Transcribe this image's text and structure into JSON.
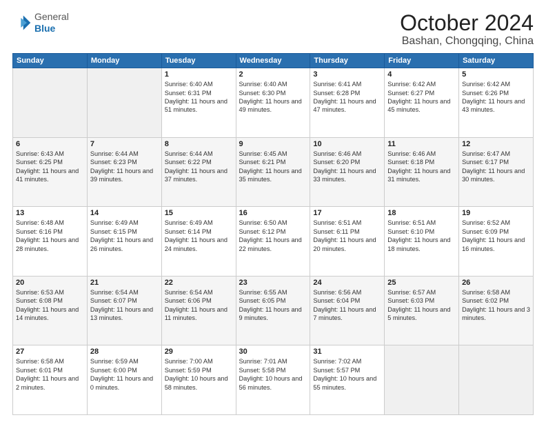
{
  "header": {
    "logo_general": "General",
    "logo_blue": "Blue",
    "title": "October 2024",
    "location": "Bashan, Chongqing, China"
  },
  "days_of_week": [
    "Sunday",
    "Monday",
    "Tuesday",
    "Wednesday",
    "Thursday",
    "Friday",
    "Saturday"
  ],
  "weeks": [
    [
      {
        "num": "",
        "empty": true
      },
      {
        "num": "",
        "empty": true
      },
      {
        "num": "1",
        "sunrise": "Sunrise: 6:40 AM",
        "sunset": "Sunset: 6:31 PM",
        "daylight": "Daylight: 11 hours and 51 minutes."
      },
      {
        "num": "2",
        "sunrise": "Sunrise: 6:40 AM",
        "sunset": "Sunset: 6:30 PM",
        "daylight": "Daylight: 11 hours and 49 minutes."
      },
      {
        "num": "3",
        "sunrise": "Sunrise: 6:41 AM",
        "sunset": "Sunset: 6:28 PM",
        "daylight": "Daylight: 11 hours and 47 minutes."
      },
      {
        "num": "4",
        "sunrise": "Sunrise: 6:42 AM",
        "sunset": "Sunset: 6:27 PM",
        "daylight": "Daylight: 11 hours and 45 minutes."
      },
      {
        "num": "5",
        "sunrise": "Sunrise: 6:42 AM",
        "sunset": "Sunset: 6:26 PM",
        "daylight": "Daylight: 11 hours and 43 minutes."
      }
    ],
    [
      {
        "num": "6",
        "sunrise": "Sunrise: 6:43 AM",
        "sunset": "Sunset: 6:25 PM",
        "daylight": "Daylight: 11 hours and 41 minutes."
      },
      {
        "num": "7",
        "sunrise": "Sunrise: 6:44 AM",
        "sunset": "Sunset: 6:23 PM",
        "daylight": "Daylight: 11 hours and 39 minutes."
      },
      {
        "num": "8",
        "sunrise": "Sunrise: 6:44 AM",
        "sunset": "Sunset: 6:22 PM",
        "daylight": "Daylight: 11 hours and 37 minutes."
      },
      {
        "num": "9",
        "sunrise": "Sunrise: 6:45 AM",
        "sunset": "Sunset: 6:21 PM",
        "daylight": "Daylight: 11 hours and 35 minutes."
      },
      {
        "num": "10",
        "sunrise": "Sunrise: 6:46 AM",
        "sunset": "Sunset: 6:20 PM",
        "daylight": "Daylight: 11 hours and 33 minutes."
      },
      {
        "num": "11",
        "sunrise": "Sunrise: 6:46 AM",
        "sunset": "Sunset: 6:18 PM",
        "daylight": "Daylight: 11 hours and 31 minutes."
      },
      {
        "num": "12",
        "sunrise": "Sunrise: 6:47 AM",
        "sunset": "Sunset: 6:17 PM",
        "daylight": "Daylight: 11 hours and 30 minutes."
      }
    ],
    [
      {
        "num": "13",
        "sunrise": "Sunrise: 6:48 AM",
        "sunset": "Sunset: 6:16 PM",
        "daylight": "Daylight: 11 hours and 28 minutes."
      },
      {
        "num": "14",
        "sunrise": "Sunrise: 6:49 AM",
        "sunset": "Sunset: 6:15 PM",
        "daylight": "Daylight: 11 hours and 26 minutes."
      },
      {
        "num": "15",
        "sunrise": "Sunrise: 6:49 AM",
        "sunset": "Sunset: 6:14 PM",
        "daylight": "Daylight: 11 hours and 24 minutes."
      },
      {
        "num": "16",
        "sunrise": "Sunrise: 6:50 AM",
        "sunset": "Sunset: 6:12 PM",
        "daylight": "Daylight: 11 hours and 22 minutes."
      },
      {
        "num": "17",
        "sunrise": "Sunrise: 6:51 AM",
        "sunset": "Sunset: 6:11 PM",
        "daylight": "Daylight: 11 hours and 20 minutes."
      },
      {
        "num": "18",
        "sunrise": "Sunrise: 6:51 AM",
        "sunset": "Sunset: 6:10 PM",
        "daylight": "Daylight: 11 hours and 18 minutes."
      },
      {
        "num": "19",
        "sunrise": "Sunrise: 6:52 AM",
        "sunset": "Sunset: 6:09 PM",
        "daylight": "Daylight: 11 hours and 16 minutes."
      }
    ],
    [
      {
        "num": "20",
        "sunrise": "Sunrise: 6:53 AM",
        "sunset": "Sunset: 6:08 PM",
        "daylight": "Daylight: 11 hours and 14 minutes."
      },
      {
        "num": "21",
        "sunrise": "Sunrise: 6:54 AM",
        "sunset": "Sunset: 6:07 PM",
        "daylight": "Daylight: 11 hours and 13 minutes."
      },
      {
        "num": "22",
        "sunrise": "Sunrise: 6:54 AM",
        "sunset": "Sunset: 6:06 PM",
        "daylight": "Daylight: 11 hours and 11 minutes."
      },
      {
        "num": "23",
        "sunrise": "Sunrise: 6:55 AM",
        "sunset": "Sunset: 6:05 PM",
        "daylight": "Daylight: 11 hours and 9 minutes."
      },
      {
        "num": "24",
        "sunrise": "Sunrise: 6:56 AM",
        "sunset": "Sunset: 6:04 PM",
        "daylight": "Daylight: 11 hours and 7 minutes."
      },
      {
        "num": "25",
        "sunrise": "Sunrise: 6:57 AM",
        "sunset": "Sunset: 6:03 PM",
        "daylight": "Daylight: 11 hours and 5 minutes."
      },
      {
        "num": "26",
        "sunrise": "Sunrise: 6:58 AM",
        "sunset": "Sunset: 6:02 PM",
        "daylight": "Daylight: 11 hours and 3 minutes."
      }
    ],
    [
      {
        "num": "27",
        "sunrise": "Sunrise: 6:58 AM",
        "sunset": "Sunset: 6:01 PM",
        "daylight": "Daylight: 11 hours and 2 minutes."
      },
      {
        "num": "28",
        "sunrise": "Sunrise: 6:59 AM",
        "sunset": "Sunset: 6:00 PM",
        "daylight": "Daylight: 11 hours and 0 minutes."
      },
      {
        "num": "29",
        "sunrise": "Sunrise: 7:00 AM",
        "sunset": "Sunset: 5:59 PM",
        "daylight": "Daylight: 10 hours and 58 minutes."
      },
      {
        "num": "30",
        "sunrise": "Sunrise: 7:01 AM",
        "sunset": "Sunset: 5:58 PM",
        "daylight": "Daylight: 10 hours and 56 minutes."
      },
      {
        "num": "31",
        "sunrise": "Sunrise: 7:02 AM",
        "sunset": "Sunset: 5:57 PM",
        "daylight": "Daylight: 10 hours and 55 minutes."
      },
      {
        "num": "",
        "empty": true
      },
      {
        "num": "",
        "empty": true
      }
    ]
  ]
}
